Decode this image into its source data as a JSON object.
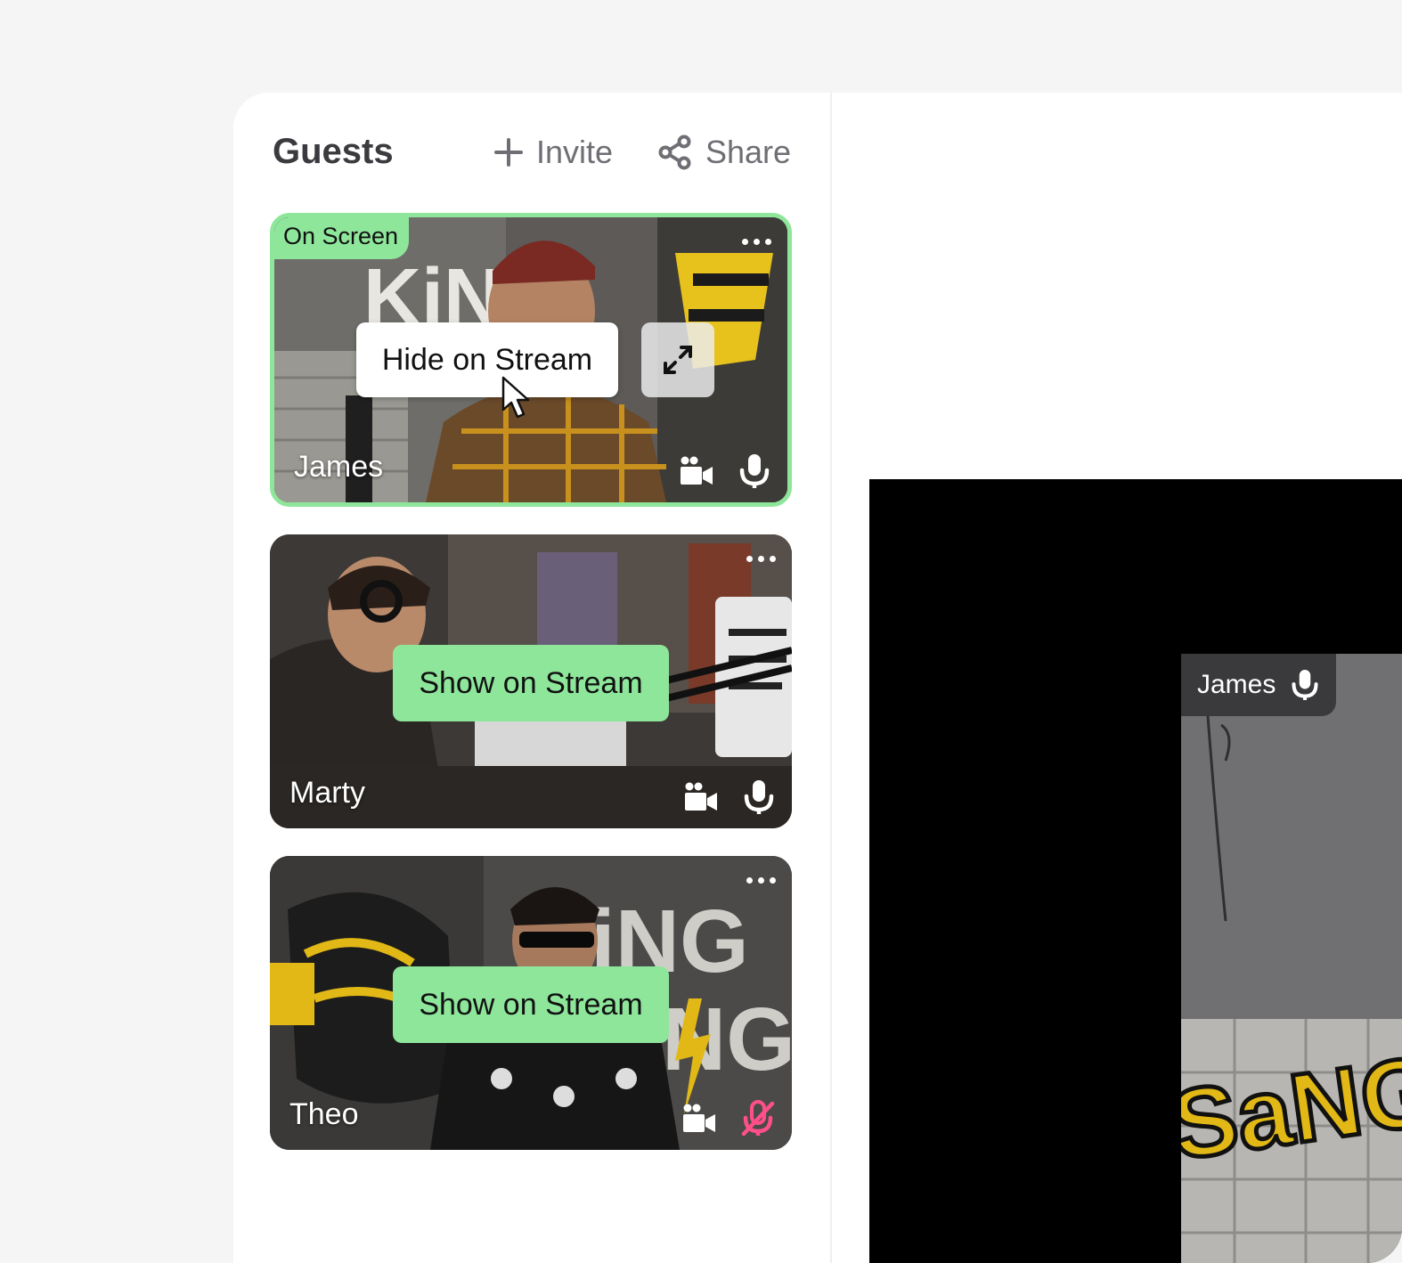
{
  "guests_panel": {
    "title": "Guests",
    "invite_label": "Invite",
    "share_label": "Share"
  },
  "guests": [
    {
      "name": "James",
      "status_tag": "On Screen",
      "action_label": "Hide on Stream",
      "mic": "on",
      "camera": "on"
    },
    {
      "name": "Marty",
      "action_label": "Show on Stream",
      "mic": "on",
      "camera": "on"
    },
    {
      "name": "Theo",
      "action_label": "Show on Stream",
      "mic": "muted",
      "camera": "on"
    }
  ],
  "stage": {
    "label_name": "James"
  },
  "colors": {
    "accent_green": "#8ee69b",
    "muted_pink": "#ff4f8b"
  }
}
